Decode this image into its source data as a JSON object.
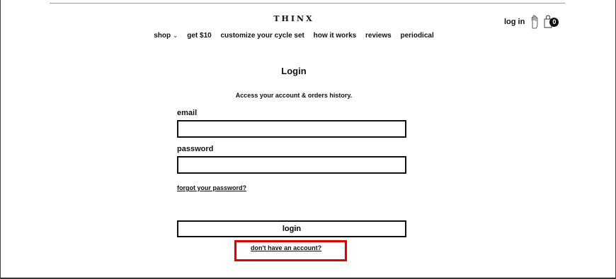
{
  "header": {
    "logo": "THINX",
    "login_link": "log in",
    "cart_count": "0"
  },
  "nav": {
    "items": [
      "shop",
      "get $10",
      "customize your cycle set",
      "how it works",
      "reviews",
      "periodical"
    ],
    "shop_caret": "⌄"
  },
  "login_form": {
    "title": "Login",
    "subtitle": "Access your account & orders history.",
    "email_label": "email",
    "email_value": "",
    "password_label": "password",
    "password_value": "",
    "forgot_link": "forgot your password?",
    "login_button": "login",
    "signup_link": "don't have an account?"
  },
  "annotation": {
    "highlight_color": "#e00000"
  }
}
